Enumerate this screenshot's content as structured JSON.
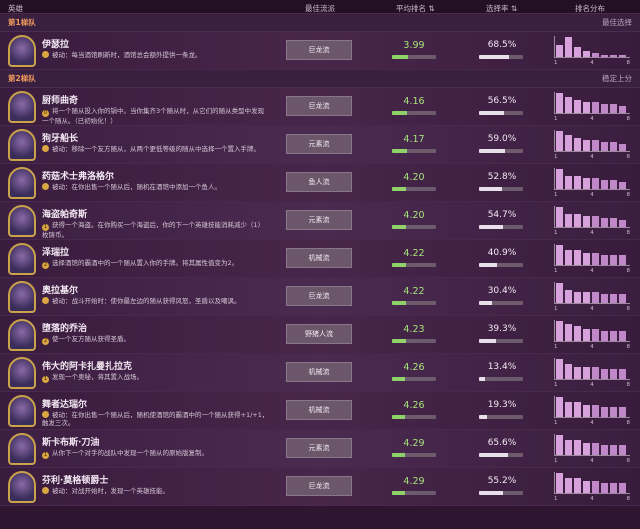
{
  "header": {
    "hero": "英雄",
    "comp": "最佳流派",
    "avg": "平均排名 ⇅",
    "pick": "选择率 ⇅",
    "dist": "排名分布"
  },
  "tiers": [
    {
      "name": "第1梯队",
      "desc": "最佳选择",
      "heroes": [
        {
          "name": "伊瑟拉",
          "ability_type": "被动",
          "ability": "每当酒馆刷新时，酒馆总会额外提供一条龙。",
          "comp": "巨龙流",
          "avg": "3.99",
          "avg_fill": 0.36,
          "pick": "68.5%",
          "pick_fill": 0.685,
          "dist": [
            6,
            10,
            5,
            3,
            2,
            1,
            1,
            1
          ]
        }
      ]
    },
    {
      "name": "第2梯队",
      "desc": "稳定上分",
      "heroes": [
        {
          "name": "厨师曲奇",
          "ability_type": "0",
          "ability": "将一个随从投入你的锅中。当你集齐3个随从时，从它们的随从类型中发现一个随从。（已初始化！）",
          "comp": "巨龙流",
          "avg": "4.16",
          "avg_fill": 0.33,
          "pick": "56.5%",
          "pick_fill": 0.565,
          "dist": [
            9,
            7,
            6,
            5,
            5,
            4,
            4,
            3
          ]
        },
        {
          "name": "狗牙船长",
          "ability_type": "被动",
          "ability": "移除一个友方随从，从两个更低等级的随从中选择一个置入手牌。",
          "comp": "元素流",
          "avg": "4.17",
          "avg_fill": 0.33,
          "pick": "59.0%",
          "pick_fill": 0.59,
          "dist": [
            9,
            7,
            6,
            5,
            5,
            4,
            4,
            3
          ]
        },
        {
          "name": "药菇术士弗洛格尔",
          "ability_type": "被动",
          "ability": "在你出售一个随从后，随机在酒馆中添加一个鱼人。",
          "comp": "鱼人流",
          "avg": "4.20",
          "avg_fill": 0.32,
          "pick": "52.8%",
          "pick_fill": 0.528,
          "dist": [
            9,
            6,
            6,
            5,
            5,
            4,
            4,
            3
          ]
        },
        {
          "name": "海盗帕奇斯",
          "ability_type": "1",
          "ability": "获得一个海盗。在你购买一个海盗后，你的下一个英雄技能消耗减少（1）枚铸币。",
          "comp": "元素流",
          "avg": "4.20",
          "avg_fill": 0.32,
          "pick": "54.7%",
          "pick_fill": 0.547,
          "dist": [
            9,
            6,
            6,
            5,
            5,
            4,
            4,
            3
          ]
        },
        {
          "name": "泽瑞拉",
          "ability_type": "2",
          "ability": "选择酒馆的霸酒中的一个随从置入你的手牌。将其属性值变为2。",
          "comp": "机械流",
          "avg": "4.22",
          "avg_fill": 0.31,
          "pick": "40.9%",
          "pick_fill": 0.409,
          "dist": [
            8,
            6,
            6,
            5,
            5,
            4,
            4,
            4
          ]
        },
        {
          "name": "奥拉基尔",
          "ability_type": "被动",
          "ability": "战斗开始时：使你最左边的随从获得风怒，圣盾以及嘲讽。",
          "comp": "巨龙流",
          "avg": "4.22",
          "avg_fill": 0.31,
          "pick": "30.4%",
          "pick_fill": 0.304,
          "dist": [
            9,
            6,
            5,
            5,
            5,
            4,
            4,
            4
          ]
        },
        {
          "name": "堕落的乔治",
          "ability_type": "2",
          "ability": "使一个友方随从获得圣盾。",
          "comp": "野猪人流",
          "avg": "4.23",
          "avg_fill": 0.31,
          "pick": "39.3%",
          "pick_fill": 0.393,
          "dist": [
            8,
            7,
            6,
            5,
            5,
            4,
            4,
            4
          ]
        },
        {
          "name": "伟大的阿卡扎曼扎拉克",
          "ability_type": "1",
          "ability": "发现一个奥秘，将其置入战场。",
          "comp": "机械流",
          "avg": "4.26",
          "avg_fill": 0.3,
          "pick": "13.4%",
          "pick_fill": 0.134,
          "dist": [
            8,
            6,
            5,
            5,
            5,
            4,
            4,
            4
          ]
        },
        {
          "name": "舞者达瑞尔",
          "ability_type": "被动",
          "ability": "在你出售一个随从后，随机使酒馆的霸酒中的一个随从获得+1/+1，触发三次。",
          "comp": "机械流",
          "avg": "4.26",
          "avg_fill": 0.3,
          "pick": "19.3%",
          "pick_fill": 0.193,
          "dist": [
            8,
            6,
            6,
            5,
            5,
            4,
            4,
            4
          ]
        },
        {
          "name": "斯卡布斯·刀油",
          "ability_type": "1",
          "ability": "从你下一个对手的战队中发现一个随从的原始版复制。",
          "comp": "元素流",
          "avg": "4.29",
          "avg_fill": 0.29,
          "pick": "65.6%",
          "pick_fill": 0.656,
          "dist": [
            8,
            6,
            6,
            5,
            5,
            4,
            4,
            4
          ]
        },
        {
          "name": "芬利·莫格顿爵士",
          "ability_type": "被动",
          "ability": "对战开始时，发现一个英雄技能。",
          "comp": "巨龙流",
          "avg": "4.29",
          "avg_fill": 0.29,
          "pick": "55.2%",
          "pick_fill": 0.552,
          "dist": [
            8,
            6,
            6,
            5,
            5,
            4,
            4,
            4
          ]
        }
      ]
    }
  ],
  "dist_labels": [
    "1",
    "4",
    "8"
  ]
}
